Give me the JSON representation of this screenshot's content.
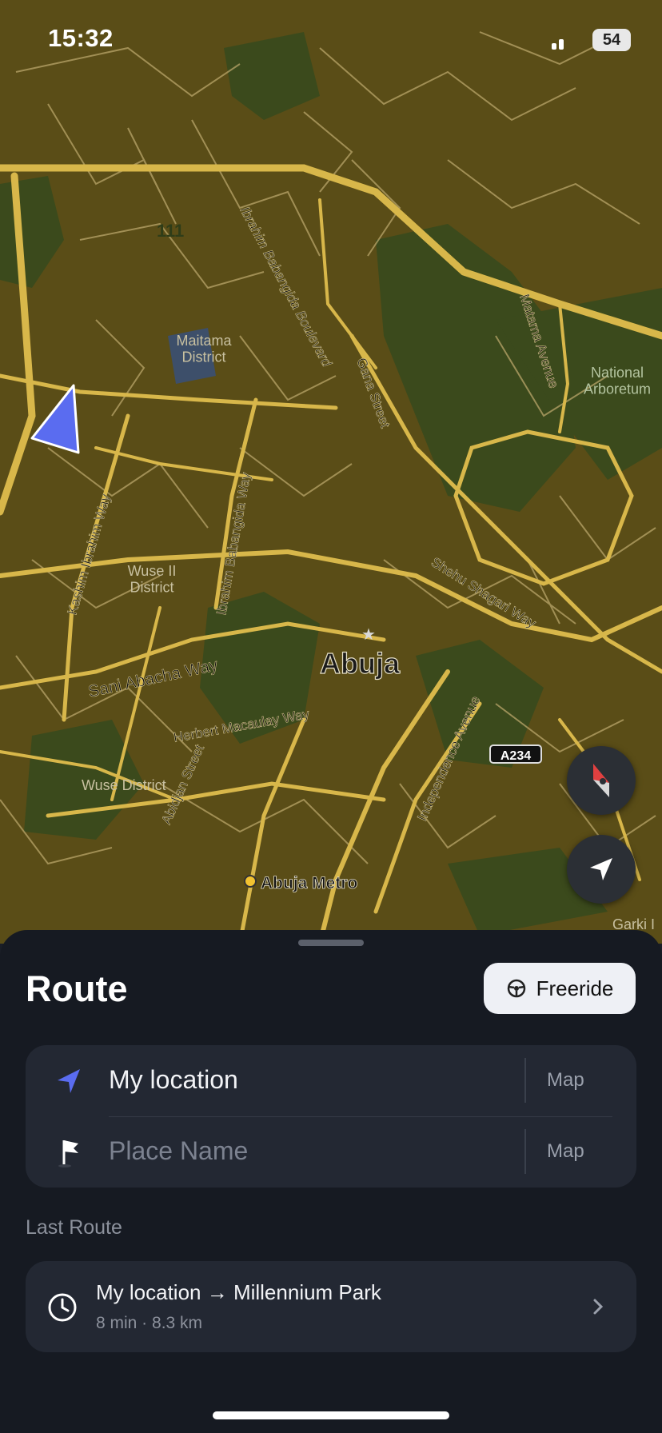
{
  "status_bar": {
    "time": "15:32",
    "battery": "54"
  },
  "map": {
    "labels": {
      "ibrahim_babangida_blvd": "Ibrahim Babangida Boulevard",
      "maitama": "Maitama\nDistrict",
      "gana": "Gana Street",
      "matama": "Matama Avenue",
      "national_arboretum": "National\nArboretum",
      "kashim": "Kashim Ibrahim Way",
      "ibrahim_way": "Ibrahim Babangida Way",
      "wuse2": "Wuse II\nDistrict",
      "shehu": "Shehu Shagari Way",
      "abuja": "Abuja",
      "sani": "Sani Abacha Way",
      "herbert": "Herbert Macaulay Way",
      "abidjan": "Abidjan Street",
      "wuse": "Wuse District",
      "independence": "Independence Avenue",
      "a234": "A234",
      "abuja_metro": "Abuja Metro",
      "garki": "Garki I",
      "road_111": "111"
    },
    "colors": {
      "land": "#5a4d17",
      "park": "#3b4a1c",
      "road": "#d8b74a",
      "minor_road": "#b9a56a"
    },
    "compass_icon": "compass-icon",
    "locate_icon": "locate-arrow-icon"
  },
  "sheet": {
    "title": "Route",
    "freeride_label": "Freeride",
    "origin": {
      "value": "My location",
      "map_label": "Map"
    },
    "destination": {
      "placeholder": "Place Name",
      "map_label": "Map"
    },
    "last_route_label": "Last Route",
    "last_route": {
      "name": "My location → Millennium Park",
      "meta": "8 min · 8.3 km"
    },
    "accent": "#5a6cf0"
  }
}
